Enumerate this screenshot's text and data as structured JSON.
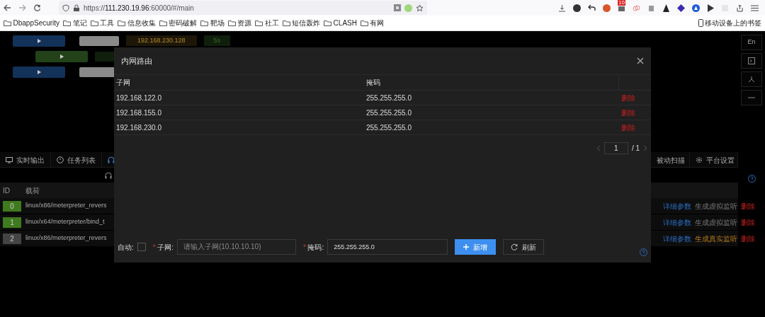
{
  "browser": {
    "url": "https://111.230.19.96:60000/#/main",
    "extension_badge": "10",
    "bookmarks": [
      "DbappSecurity",
      "笔记",
      "工具",
      "信息收集",
      "密码破解",
      "靶场",
      "资源",
      "社工",
      "短信轰炸",
      "CLASH",
      "有网"
    ],
    "mobile_bookmarks": "移动设备上的书签"
  },
  "sessions": [
    {
      "color": "#13325a",
      "indent": false,
      "ip": "192.168.230.128",
      "time": "5s"
    },
    {
      "color": "#23421a",
      "indent": true
    },
    {
      "color": "#13325a",
      "indent": false
    }
  ],
  "side_button": "En",
  "tabs_left": [
    {
      "label": "实时输出",
      "selected": false
    },
    {
      "label": "任务列表",
      "selected": false
    },
    {
      "selected": true
    }
  ],
  "tabs_right": [
    {
      "label": "被动扫描",
      "selected": false
    },
    {
      "label": "平台设置",
      "selected": false
    }
  ],
  "listeners": {
    "columns": [
      "ID",
      "载荷"
    ],
    "rows": [
      {
        "id": "0",
        "active": true,
        "payload": "linux/x86/meterpreter_revers",
        "details": "详细参数",
        "listen": "生成虚拟监听",
        "kind": "virtual",
        "delete": "删除"
      },
      {
        "id": "1",
        "active": true,
        "payload": "linux/x64/meterpreter/bind_t",
        "details": "详细参数",
        "listen": "生成虚拟监听",
        "kind": "virtual",
        "delete": "删除"
      },
      {
        "id": "2",
        "active": false,
        "payload": "linux/x86/meterpreter_revers",
        "details": "详细参数",
        "listen": "生成真实监听",
        "kind": "real",
        "delete": "删除"
      }
    ]
  },
  "modal": {
    "title": "内网路由",
    "columns": [
      "子网",
      "掩码"
    ],
    "rows": [
      {
        "subnet": "192.168.122.0",
        "mask": "255.255.255.0",
        "action": "删除"
      },
      {
        "subnet": "192.168.155.0",
        "mask": "255.255.255.0",
        "action": "删除"
      },
      {
        "subnet": "192.168.230.0",
        "mask": "255.255.255.0",
        "action": "删除"
      }
    ],
    "pagination": {
      "page": "1",
      "total": "/ 1"
    },
    "form": {
      "auto_label": "自动:",
      "auto_checked": false,
      "subnet_mark": "*",
      "subnet_label": "子网:",
      "mask_mark": "*",
      "subnet_placeholder": "请输入子网(10.10.10.10)",
      "mask_label": "掩码:",
      "mask_value": "255.255.255.0",
      "add_button": "新增",
      "refresh_button": "刷新"
    }
  }
}
